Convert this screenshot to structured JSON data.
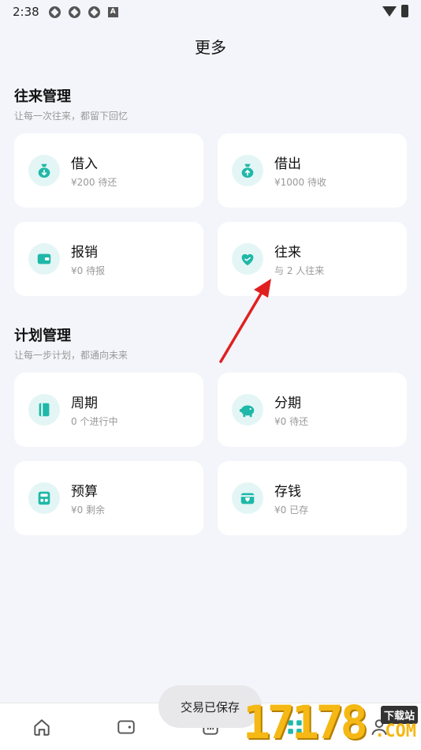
{
  "status_bar": {
    "time": "2:38",
    "notif_letter": "A"
  },
  "page": {
    "title": "更多"
  },
  "sections": [
    {
      "title": "往来管理",
      "subtitle": "让每一次往来，都留下回忆",
      "cards": [
        {
          "label": "借入",
          "sub": "¥200 待还",
          "icon": "money-bag-down-icon"
        },
        {
          "label": "借出",
          "sub": "¥1000 待收",
          "icon": "money-bag-up-icon"
        },
        {
          "label": "报销",
          "sub": "¥0 待报",
          "icon": "wallet-icon"
        },
        {
          "label": "往来",
          "sub": "与 2 人往来",
          "icon": "handshake-heart-icon"
        }
      ]
    },
    {
      "title": "计划管理",
      "subtitle": "让每一步计划，都通向未来",
      "cards": [
        {
          "label": "周期",
          "sub": "0 个进行中",
          "icon": "notebook-icon"
        },
        {
          "label": "分期",
          "sub": "¥0 待还",
          "icon": "piggy-bank-icon"
        },
        {
          "label": "预算",
          "sub": "¥0 剩余",
          "icon": "calculator-icon"
        },
        {
          "label": "存钱",
          "sub": "¥0 已存",
          "icon": "savings-box-icon"
        }
      ]
    }
  ],
  "toast": {
    "text": "交易已保存"
  },
  "bottom_nav": [
    "home-icon",
    "wallet-icon",
    "stats-icon",
    "apps-icon",
    "profile-icon"
  ],
  "watermark": {
    "digits": "17178",
    "site_label": "下载站",
    "domain": ".COM"
  },
  "colors": {
    "accent": "#1fb8a8",
    "icon_bg": "#e3f6f5",
    "background": "#f3f5fa",
    "annotation": "#e02020"
  }
}
